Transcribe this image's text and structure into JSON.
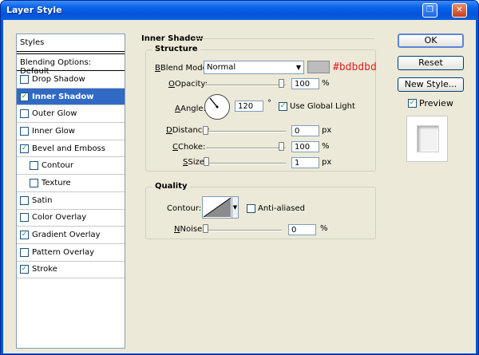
{
  "window": {
    "title": "Layer Style"
  },
  "titlebar_buttons": [
    "restore",
    "close"
  ],
  "styles": {
    "header": "Styles",
    "blending_options": "Blending Options: Default",
    "items": [
      {
        "label": "Drop Shadow",
        "checked": false,
        "selected": false,
        "indent": false
      },
      {
        "label": "Inner Shadow",
        "checked": true,
        "selected": true,
        "indent": false
      },
      {
        "label": "Outer Glow",
        "checked": false,
        "selected": false,
        "indent": false
      },
      {
        "label": "Inner Glow",
        "checked": false,
        "selected": false,
        "indent": false
      },
      {
        "label": "Bevel and Emboss",
        "checked": true,
        "selected": false,
        "indent": false
      },
      {
        "label": "Contour",
        "checked": false,
        "selected": false,
        "indent": true
      },
      {
        "label": "Texture",
        "checked": false,
        "selected": false,
        "indent": true
      },
      {
        "label": "Satin",
        "checked": false,
        "selected": false,
        "indent": false
      },
      {
        "label": "Color Overlay",
        "checked": false,
        "selected": false,
        "indent": false
      },
      {
        "label": "Gradient Overlay",
        "checked": true,
        "selected": false,
        "indent": false
      },
      {
        "label": "Pattern Overlay",
        "checked": false,
        "selected": false,
        "indent": false
      },
      {
        "label": "Stroke",
        "checked": true,
        "selected": false,
        "indent": false
      }
    ]
  },
  "inner_shadow": {
    "title": "Inner Shadow",
    "structure": {
      "title": "Structure",
      "blend_mode_label": "Blend Mode:",
      "blend_mode": "Normal",
      "color": "#bdbdbd",
      "color_annotation": "#bdbdbd",
      "opacity_label": "Opacity:",
      "opacity": "100",
      "angle_label": "Angle:",
      "angle": "120",
      "angle_unit": "°",
      "use_global_light_label": "Use Global Light",
      "use_global_light": true,
      "distance_label": "Distance:",
      "distance": "0",
      "choke_label": "Choke:",
      "choke": "100",
      "size_label": "Size:",
      "size": "1",
      "units": {
        "percent": "%",
        "px": "px"
      }
    },
    "quality": {
      "title": "Quality",
      "contour_label": "Contour:",
      "anti_aliased_label": "Anti-aliased",
      "anti_aliased": false,
      "noise_label": "Noise:",
      "noise": "0",
      "noise_unit": "%"
    }
  },
  "buttons": {
    "ok": "OK",
    "reset": "Reset",
    "new_style": "New Style...",
    "preview_label": "Preview",
    "preview_checked": true
  }
}
